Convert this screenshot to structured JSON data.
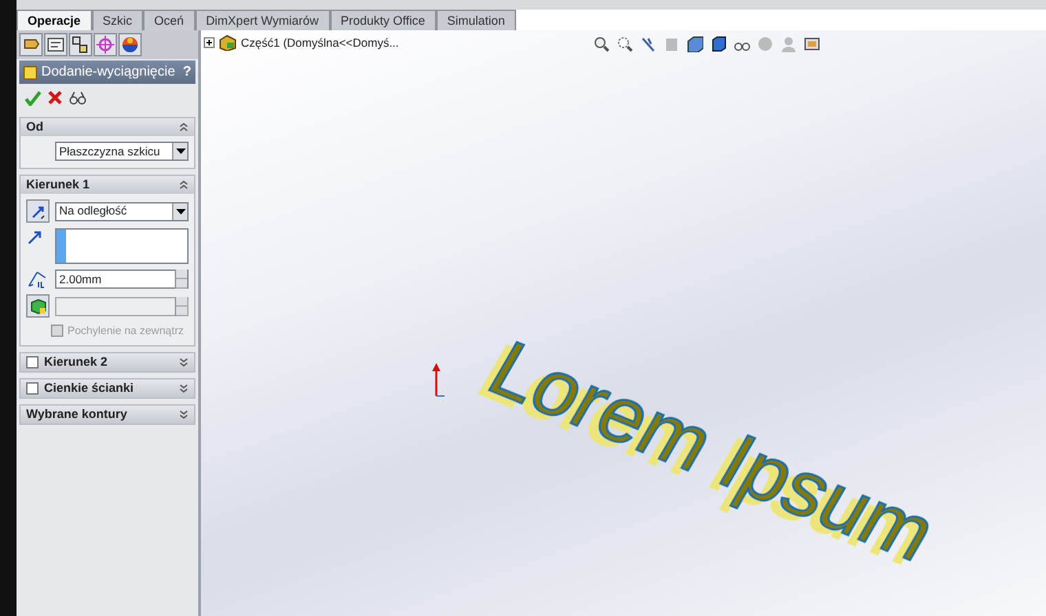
{
  "tabs": [
    {
      "label": "Operacje",
      "selected": true
    },
    {
      "label": "Szkic",
      "selected": false
    },
    {
      "label": "Oceń",
      "selected": false
    },
    {
      "label": "DimXpert Wymiarów",
      "selected": false
    },
    {
      "label": "Produkty Office",
      "selected": false
    },
    {
      "label": "Simulation",
      "selected": false
    }
  ],
  "feature": {
    "title": "Dodanie-wyciągnięcie",
    "help": "?"
  },
  "sections": [
    {
      "kind": "from",
      "title": "Od",
      "expanded": true,
      "dropdown": "Płaszczyzna szkicu"
    },
    {
      "kind": "direction",
      "title": "Kierunek 1",
      "expanded": true,
      "dropdown": "Na odległość",
      "depth": "2.00mm",
      "draft_label": "Pochylenie na zewnątrz",
      "draft_checked": false
    },
    {
      "kind": "option",
      "title": "Kierunek 2",
      "expanded": false,
      "checked": false
    },
    {
      "kind": "option",
      "title": "Cienkie ścianki",
      "expanded": false,
      "checked": false
    },
    {
      "kind": "plain",
      "title": "Wybrane kontury",
      "expanded": false
    }
  ],
  "tree": {
    "label": "Część1  (Domyślna<<Domyś...",
    "expanded": false
  },
  "model_text": "Lorem Ipsum"
}
